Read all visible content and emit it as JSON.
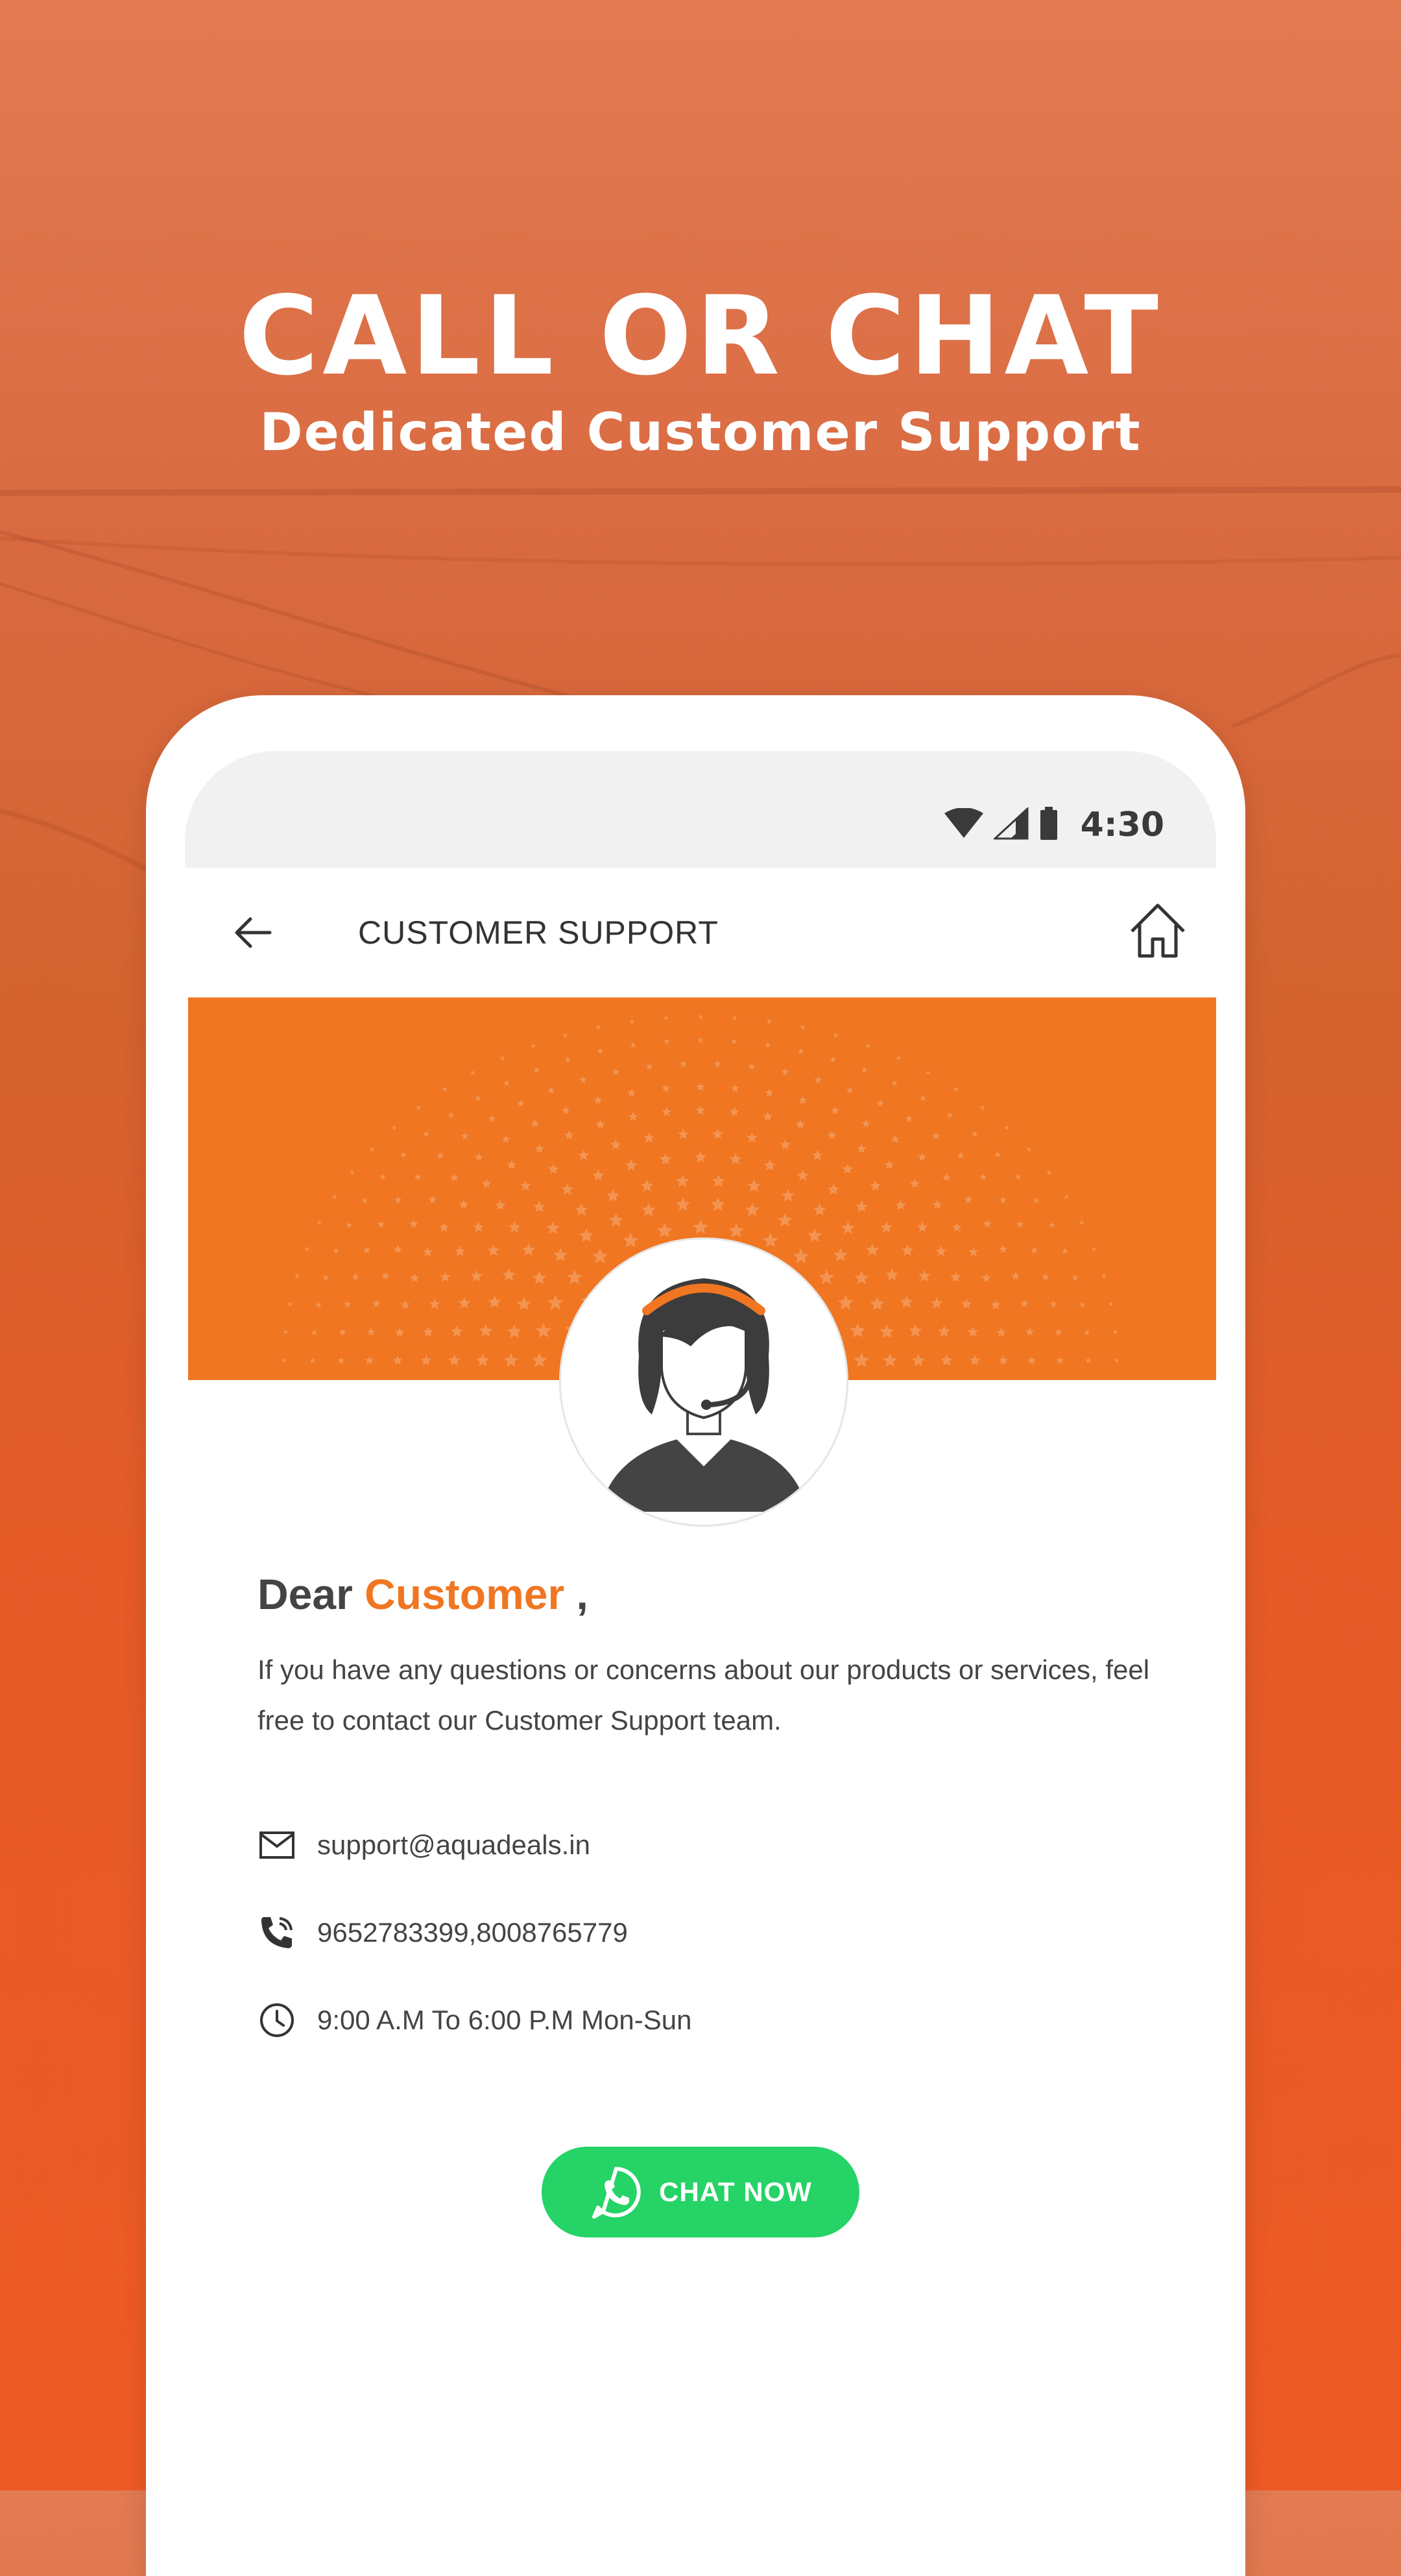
{
  "hero": {
    "title": "CALL OR CHAT",
    "subtitle": "Dedicated Customer Support"
  },
  "status_bar": {
    "time": "4:30",
    "icons": [
      "wifi-icon",
      "signal-icon",
      "battery-icon"
    ]
  },
  "app_bar": {
    "title": "CUSTOMER SUPPORT",
    "back_icon": "arrow-left-icon",
    "home_icon": "home-icon"
  },
  "greeting": {
    "prefix": "Dear",
    "name": "Customer",
    "suffix": ","
  },
  "intro_text": "If you have any questions or concerns about our products or services, feel free to contact our Customer Support team.",
  "contact": {
    "email": "support@aquadeals.in",
    "phone": "9652783399,8008765779",
    "hours": "9:00 A.M To 6:00 P.M Mon-Sun"
  },
  "chat_button": {
    "label": "CHAT NOW",
    "icon": "whatsapp-icon"
  },
  "colors": {
    "accent": "#f07622",
    "whatsapp": "#25d366",
    "background": "#ee5a24"
  }
}
